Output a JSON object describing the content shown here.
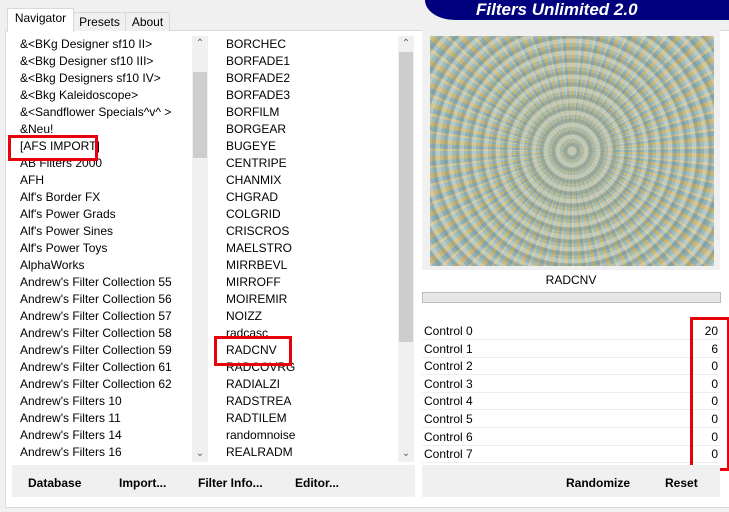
{
  "title": "Filters Unlimited 2.0",
  "tabs": [
    {
      "label": "Navigator"
    },
    {
      "label": "Presets"
    },
    {
      "label": "About"
    }
  ],
  "categories": [
    "&<BKg Designer sf10 II>",
    "&<Bkg Designer sf10 III>",
    "&<Bkg Designers sf10 IV>",
    "&<Bkg Kaleidoscope>",
    "&<Sandflower Specials^v^ >",
    "&Neu!",
    "[AFS IMPORT]",
    "AB Filters 2000",
    "AFH",
    "Alf's Border FX",
    "Alf's Power Grads",
    "Alf's Power Sines",
    "Alf's Power Toys",
    "AlphaWorks",
    "Andrew's Filter Collection 55",
    "Andrew's Filter Collection 56",
    "Andrew's Filter Collection 57",
    "Andrew's Filter Collection 58",
    "Andrew's Filter Collection 59",
    "Andrew's Filter Collection 61",
    "Andrew's Filter Collection 62",
    "Andrew's Filters 10",
    "Andrew's Filters 11",
    "Andrew's Filters 14",
    "Andrew's Filters 16"
  ],
  "filters": [
    "BORCHEC",
    "BORFADE1",
    "BORFADE2",
    "BORFADE3",
    "BORFILM",
    "BORGEAR",
    "BUGEYE",
    "CENTRIPE",
    "CHANMIX",
    "CHGRAD",
    "COLGRID",
    "CRISCROS",
    "MAELSTRO",
    "MIRRBEVL",
    "MIRROFF",
    "MOIREMIR",
    "NOIZZ",
    "radcasc",
    "RADCNV",
    "RADCOVRG",
    "RADIALZI",
    "RADSTREA",
    "RADTILEM",
    "randomnoise",
    "REALRADM"
  ],
  "selected_category": "[AFS IMPORT]",
  "selected_filter": "RADCNV",
  "filter_name": "RADCNV",
  "controls": [
    {
      "label": "Control 0",
      "value": "20"
    },
    {
      "label": "Control 1",
      "value": "6"
    },
    {
      "label": "Control 2",
      "value": "0"
    },
    {
      "label": "Control 3",
      "value": "0"
    },
    {
      "label": "Control 4",
      "value": "0"
    },
    {
      "label": "Control 5",
      "value": "0"
    },
    {
      "label": "Control 6",
      "value": "0"
    },
    {
      "label": "Control 7",
      "value": "0"
    }
  ],
  "buttons": {
    "database": "Database",
    "import": "Import...",
    "filter_info": "Filter Info...",
    "editor": "Editor...",
    "randomize": "Randomize",
    "reset": "Reset"
  },
  "colors": {
    "banner": "#00007f",
    "highlight": "#e8000b"
  }
}
